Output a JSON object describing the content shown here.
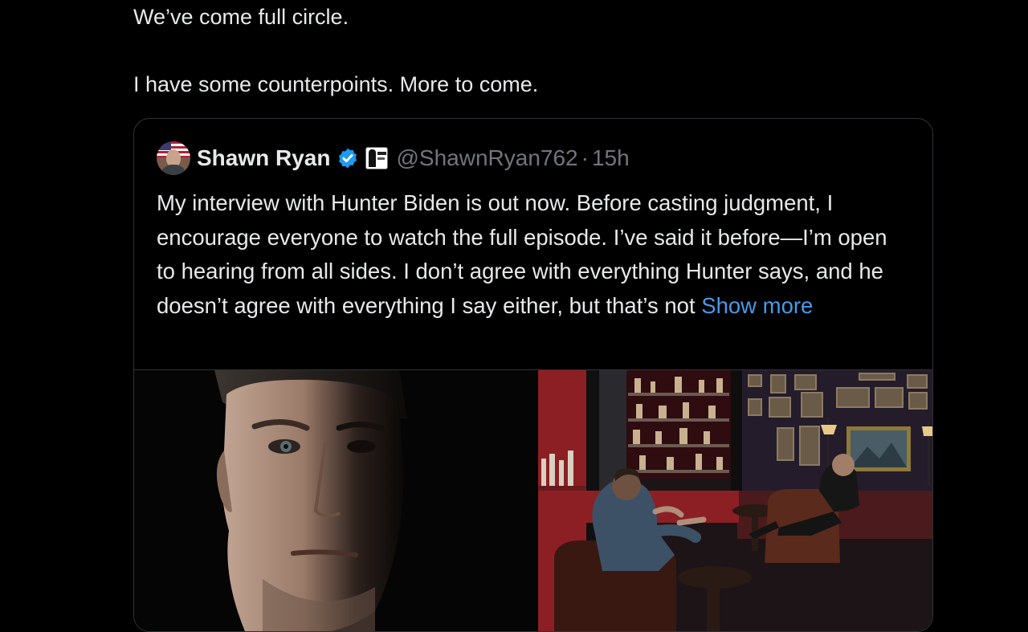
{
  "tweet": {
    "line1": "We’ve come full circle.",
    "line2": "I have some counterpoints. More to come."
  },
  "quote": {
    "author_name": "Shawn Ryan",
    "handle": "@ShawnRyan762",
    "separator": "·",
    "time": "15h",
    "body_text": "My interview with Hunter Biden is out now. Before casting judgment, I encourage everyone to watch the full episode. I’ve said it before—I’m open to hearing from all sides. I don’t agree with everything Hunter says, and he doesn’t agree with everything I say either, but that’s not ",
    "show_more": "Show more",
    "icons": {
      "verified": "verified-badge-icon",
      "affiliate": "affiliate-badge-icon",
      "avatar": "avatar"
    }
  },
  "colors": {
    "background": "#000000",
    "text": "#e7e9ea",
    "muted": "#71767b",
    "link": "#4a99e9",
    "verified": "#1d9bf0",
    "border": "#2f3336"
  }
}
